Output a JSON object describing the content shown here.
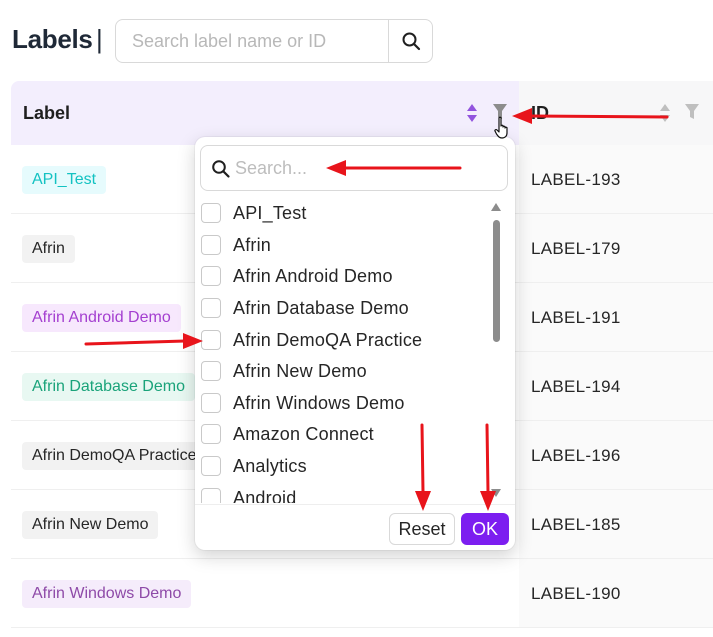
{
  "header": {
    "title": "Labels",
    "separator": "|",
    "search_placeholder": "Search label name or ID"
  },
  "table": {
    "columns": [
      {
        "title": "Label"
      },
      {
        "title": "ID"
      }
    ],
    "rows": [
      {
        "label": "API_Test",
        "id": "LABEL-193",
        "tag_bg": "#e6fbfd",
        "tag_fg": "#13c2c2"
      },
      {
        "label": "Afrin",
        "id": "LABEL-179",
        "tag_bg": "#f2f2f2",
        "tag_fg": "#262626"
      },
      {
        "label": "Afrin Android Demo",
        "id": "LABEL-191",
        "tag_bg": "#f7e8fd",
        "tag_fg": "#a43fd0"
      },
      {
        "label": "Afrin Database Demo",
        "id": "LABEL-194",
        "tag_bg": "#e8f8f2",
        "tag_fg": "#1aa37a"
      },
      {
        "label": "Afrin DemoQA Practice",
        "id": "LABEL-196",
        "tag_bg": "#f2f2f2",
        "tag_fg": "#262626"
      },
      {
        "label": "Afrin New Demo",
        "id": "LABEL-185",
        "tag_bg": "#f2f2f2",
        "tag_fg": "#262626"
      },
      {
        "label": "Afrin Windows Demo",
        "id": "LABEL-190",
        "tag_bg": "#f5ecfb",
        "tag_fg": "#8e4aa8"
      }
    ]
  },
  "filter_dropdown": {
    "search_placeholder": "Search...",
    "options": [
      "API_Test",
      "Afrin",
      "Afrin Android Demo",
      "Afrin Database Demo",
      "Afrin DemoQA Practice",
      "Afrin New Demo",
      "Afrin Windows Demo",
      "Amazon Connect",
      "Analytics",
      "Android"
    ],
    "reset_label": "Reset",
    "ok_label": "OK"
  },
  "colors": {
    "accent": "#7c1ef0",
    "header_bg": "#f3eefd",
    "annotation": "#e8141b"
  },
  "icons": [
    "search-icon",
    "sort-icon",
    "filter-icon",
    "pointer-cursor-icon",
    "checkbox-icon"
  ]
}
